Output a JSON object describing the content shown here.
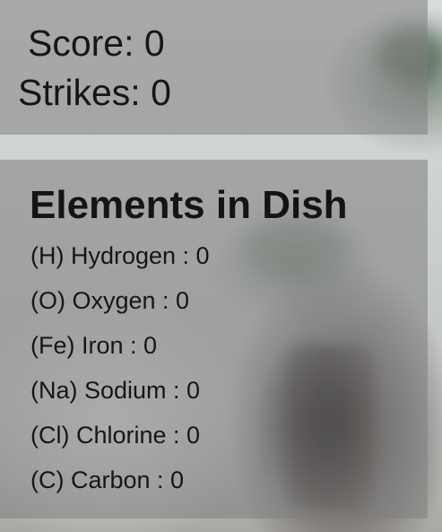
{
  "hud": {
    "score_text": "Score: 0",
    "strikes_text": "Strikes: 0"
  },
  "dish": {
    "title": "Elements in Dish",
    "elements": [
      {
        "label": "(H) Hydrogen : 0"
      },
      {
        "label": "(O) Oxygen : 0"
      },
      {
        "label": "(Fe) Iron : 0"
      },
      {
        "label": "(Na) Sodium : 0"
      },
      {
        "label": "(Cl) Chlorine : 0"
      },
      {
        "label": "(C) Carbon : 0"
      }
    ]
  },
  "colors": {
    "panel": "#808080",
    "text": "#161616"
  }
}
